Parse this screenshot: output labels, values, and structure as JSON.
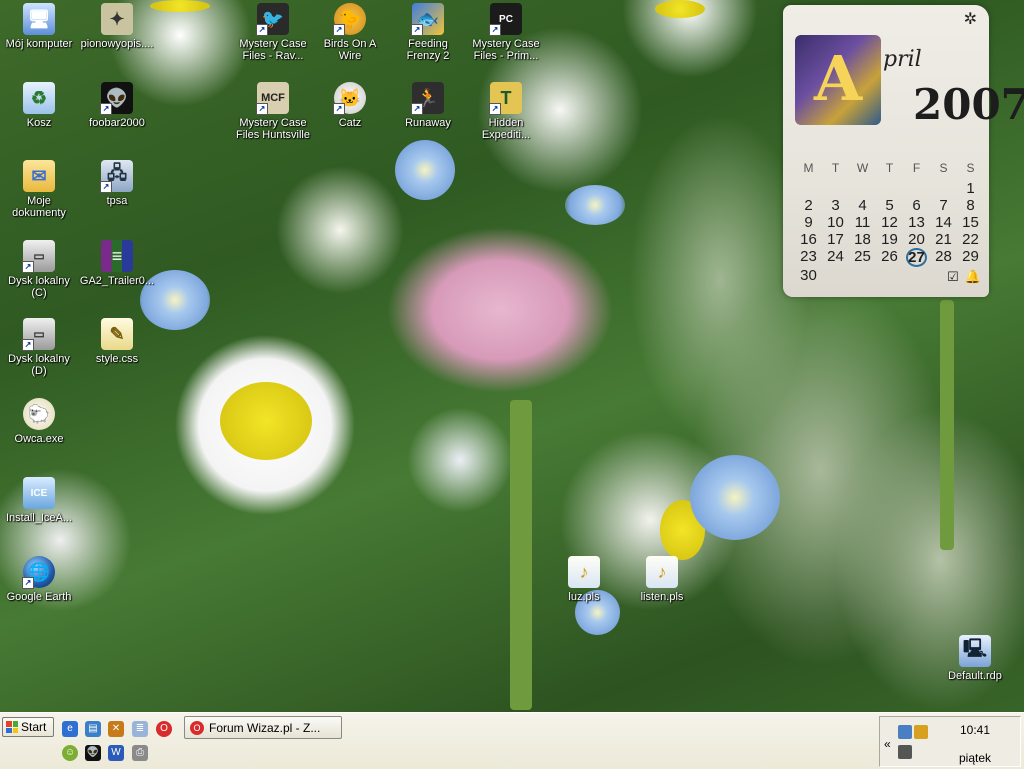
{
  "desktop": {
    "icons": [
      {
        "label": "Mój komputer",
        "icon": "computer-icon",
        "shortcut": false
      },
      {
        "label": "pionowyopis....",
        "icon": "joystick-icon",
        "shortcut": false
      },
      {
        "label": "Mystery Case Files - Rav...",
        "icon": "game-raven-icon",
        "shortcut": true
      },
      {
        "label": "Birds On A Wire",
        "icon": "game-bird-icon",
        "shortcut": true
      },
      {
        "label": "Feeding Frenzy 2",
        "icon": "game-fish-icon",
        "shortcut": true
      },
      {
        "label": "Mystery Case Files - Prim...",
        "icon": "game-prime-icon",
        "shortcut": true
      },
      {
        "label": "Kosz",
        "icon": "recycle-bin-icon",
        "shortcut": false
      },
      {
        "label": "foobar2000",
        "icon": "foobar-icon",
        "shortcut": true
      },
      {
        "label": "Mystery Case Files Huntsville",
        "icon": "game-mcf-icon",
        "shortcut": true
      },
      {
        "label": "Catz",
        "icon": "game-cat-icon",
        "shortcut": true
      },
      {
        "label": "Runaway",
        "icon": "game-runaway-icon",
        "shortcut": true
      },
      {
        "label": "Hidden Expediti...",
        "icon": "game-hidden-icon",
        "shortcut": true
      },
      {
        "label": "Moje dokumenty",
        "icon": "folder-icon",
        "shortcut": false
      },
      {
        "label": "tpsa",
        "icon": "network-icon",
        "shortcut": true
      },
      {
        "label": "Dysk lokalny (C)",
        "icon": "drive-icon",
        "shortcut": true
      },
      {
        "label": "GA2_Trailer0...",
        "icon": "winrar-icon",
        "shortcut": false
      },
      {
        "label": "Dysk lokalny (D)",
        "icon": "drive-icon",
        "shortcut": true
      },
      {
        "label": "style.css",
        "icon": "css-file-icon",
        "shortcut": false
      },
      {
        "label": "Owca.exe",
        "icon": "sheep-icon",
        "shortcut": false
      },
      {
        "label": "Install_IceA...",
        "icon": "ice-age-icon",
        "shortcut": false
      },
      {
        "label": "Google Earth",
        "icon": "globe-icon",
        "shortcut": true
      },
      {
        "label": "luz.pls",
        "icon": "playlist-icon",
        "shortcut": false
      },
      {
        "label": "listen.pls",
        "icon": "playlist-icon",
        "shortcut": false
      },
      {
        "label": "Default.rdp",
        "icon": "remote-desktop-icon",
        "shortcut": false
      }
    ]
  },
  "calendar": {
    "initial": "A",
    "month_rest": "pril",
    "year": "2007",
    "weekdays": [
      "M",
      "T",
      "W",
      "T",
      "F",
      "S",
      "S"
    ],
    "days": [
      "",
      "",
      "",
      "",
      "",
      "",
      "1",
      "2",
      "3",
      "4",
      "5",
      "6",
      "7",
      "8",
      "9",
      "10",
      "11",
      "12",
      "13",
      "14",
      "15",
      "16",
      "17",
      "18",
      "19",
      "20",
      "21",
      "22",
      "23",
      "24",
      "25",
      "26",
      "27",
      "28",
      "29",
      "30",
      "",
      "",
      "",
      "",
      "",
      ""
    ],
    "today": "27",
    "tools": [
      "☑",
      "🔔"
    ]
  },
  "taskbar": {
    "start_label": "Start",
    "task_label": "Forum Wizaz.pl - Z...",
    "tray_chevron": "«",
    "clock": "10:41",
    "day": "piątek"
  },
  "colors": {
    "taskbar": "#ece9d8",
    "today_ring": "#2a6fa0"
  }
}
